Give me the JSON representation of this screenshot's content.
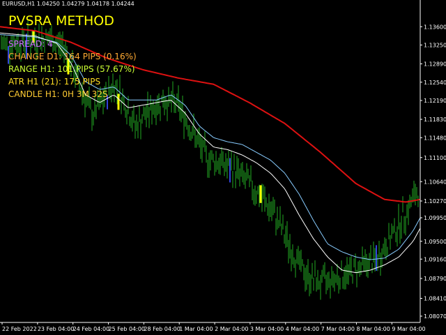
{
  "header": {
    "symbol": "EURUSD,H1  1.04250 1.04279 1.04178 1.04244"
  },
  "overlay": {
    "title": "PVSRA METHOD",
    "title_color": "#ffff00",
    "lines": [
      {
        "text": "SPREAD: 4",
        "color": "#cc66ff"
      },
      {
        "text": "CHANGE D1: 164 PIPS (0.16%)",
        "color": "#ffaa33"
      },
      {
        "text": "RANGE H1: 101 PIPS (57.67%)",
        "color": "#ccff33"
      },
      {
        "text": "ATR H1 (21): 175 PIPS",
        "color": "#ffdd22"
      },
      {
        "text": "CANDLE H1: 0H 3M 32S",
        "color": "#ffcc33"
      }
    ]
  },
  "colors": {
    "background": "#000000",
    "candle_normal": "#22aa22",
    "candle_climax": "#ffff00",
    "candle_low_vol": "#3344dd",
    "ma_slow": "#dd1111",
    "ma_mid": "#88ccff",
    "ma_fast": "#ffffff",
    "axis": "#ffffff"
  },
  "chart_data": {
    "type": "line",
    "ylim": [
      1.0795,
      1.1395
    ],
    "y_ticks": [
      "1.13600",
      "1.13250",
      "1.12890",
      "1.12540",
      "1.12190",
      "1.11830",
      "1.11480",
      "1.11100",
      "1.10640",
      "1.10270",
      "1.09950",
      "1.09500",
      "1.09160",
      "1.08790",
      "1.08410",
      "1.08070"
    ],
    "x_ticks": [
      "22 Feb 2022",
      "23 Feb 04:00",
      "24 Feb 04:00",
      "25 Feb 04:00",
      "28 Feb 04:00",
      "1 Mar 04:00",
      "2 Mar 04:00",
      "3 Mar 04:00",
      "4 Mar 04:00",
      "7 Mar 04:00",
      "8 Mar 04:00",
      "9 Mar 04:00"
    ],
    "close_path": [
      [
        0,
        1.1325
      ],
      [
        3,
        1.133
      ],
      [
        5,
        1.1335
      ],
      [
        7,
        1.1337
      ],
      [
        9,
        1.132
      ],
      [
        11,
        1.1255
      ],
      [
        13,
        1.119
      ],
      [
        14,
        1.121
      ],
      [
        16,
        1.125
      ],
      [
        17,
        1.123
      ],
      [
        19,
        1.117
      ],
      [
        21,
        1.12
      ],
      [
        23,
        1.122
      ],
      [
        25,
        1.121
      ],
      [
        27,
        1.116
      ],
      [
        29,
        1.111
      ],
      [
        31,
        1.11
      ],
      [
        33,
        1.1085
      ],
      [
        35,
        1.106
      ],
      [
        37,
        1.103
      ],
      [
        39,
        1.099
      ],
      [
        41,
        1.093
      ],
      [
        43,
        1.0885
      ],
      [
        45,
        1.087
      ],
      [
        47,
        1.088
      ],
      [
        49,
        1.089
      ],
      [
        51,
        1.0905
      ],
      [
        53,
        1.0915
      ],
      [
        55,
        1.096
      ],
      [
        57,
        1.1005
      ],
      [
        59,
        1.1055
      ]
    ],
    "ma_slow": [
      [
        0,
        1.136
      ],
      [
        5,
        1.1352
      ],
      [
        10,
        1.133
      ],
      [
        15,
        1.13
      ],
      [
        20,
        1.1278
      ],
      [
        25,
        1.1262
      ],
      [
        30,
        1.125
      ],
      [
        35,
        1.1215
      ],
      [
        40,
        1.1175
      ],
      [
        45,
        1.112
      ],
      [
        50,
        1.106
      ],
      [
        54,
        1.103
      ],
      [
        57,
        1.1025
      ],
      [
        59,
        1.103
      ]
    ],
    "ma_mid": [
      [
        0,
        1.1345
      ],
      [
        5,
        1.134
      ],
      [
        8,
        1.133
      ],
      [
        10,
        1.1305
      ],
      [
        12,
        1.1255
      ],
      [
        14,
        1.124
      ],
      [
        16,
        1.1245
      ],
      [
        18,
        1.122
      ],
      [
        20,
        1.122
      ],
      [
        22,
        1.122
      ],
      [
        24,
        1.123
      ],
      [
        26,
        1.121
      ],
      [
        28,
        1.117
      ],
      [
        30,
        1.1148
      ],
      [
        32,
        1.114
      ],
      [
        34,
        1.1135
      ],
      [
        36,
        1.112
      ],
      [
        38,
        1.1105
      ],
      [
        40,
        1.108
      ],
      [
        42,
        1.104
      ],
      [
        44,
        1.099
      ],
      [
        46,
        1.0945
      ],
      [
        48,
        1.093
      ],
      [
        50,
        1.092
      ],
      [
        52,
        1.0915
      ],
      [
        54,
        1.0918
      ],
      [
        56,
        1.0935
      ],
      [
        58,
        1.097
      ],
      [
        59,
        1.0995
      ]
    ],
    "ma_fast": [
      [
        0,
        1.1348
      ],
      [
        5,
        1.1342
      ],
      [
        8,
        1.1328
      ],
      [
        10,
        1.129
      ],
      [
        12,
        1.123
      ],
      [
        14,
        1.1215
      ],
      [
        16,
        1.123
      ],
      [
        18,
        1.1205
      ],
      [
        20,
        1.121
      ],
      [
        22,
        1.1215
      ],
      [
        24,
        1.122
      ],
      [
        26,
        1.1195
      ],
      [
        28,
        1.1155
      ],
      [
        30,
        1.113
      ],
      [
        32,
        1.1125
      ],
      [
        34,
        1.1115
      ],
      [
        36,
        1.11
      ],
      [
        38,
        1.108
      ],
      [
        40,
        1.105
      ],
      [
        42,
        1.1
      ],
      [
        44,
        1.0955
      ],
      [
        46,
        1.092
      ],
      [
        48,
        1.0895
      ],
      [
        50,
        1.089
      ],
      [
        52,
        1.0895
      ],
      [
        54,
        1.0905
      ],
      [
        56,
        1.092
      ],
      [
        58,
        1.095
      ],
      [
        59,
        1.0975
      ]
    ]
  }
}
